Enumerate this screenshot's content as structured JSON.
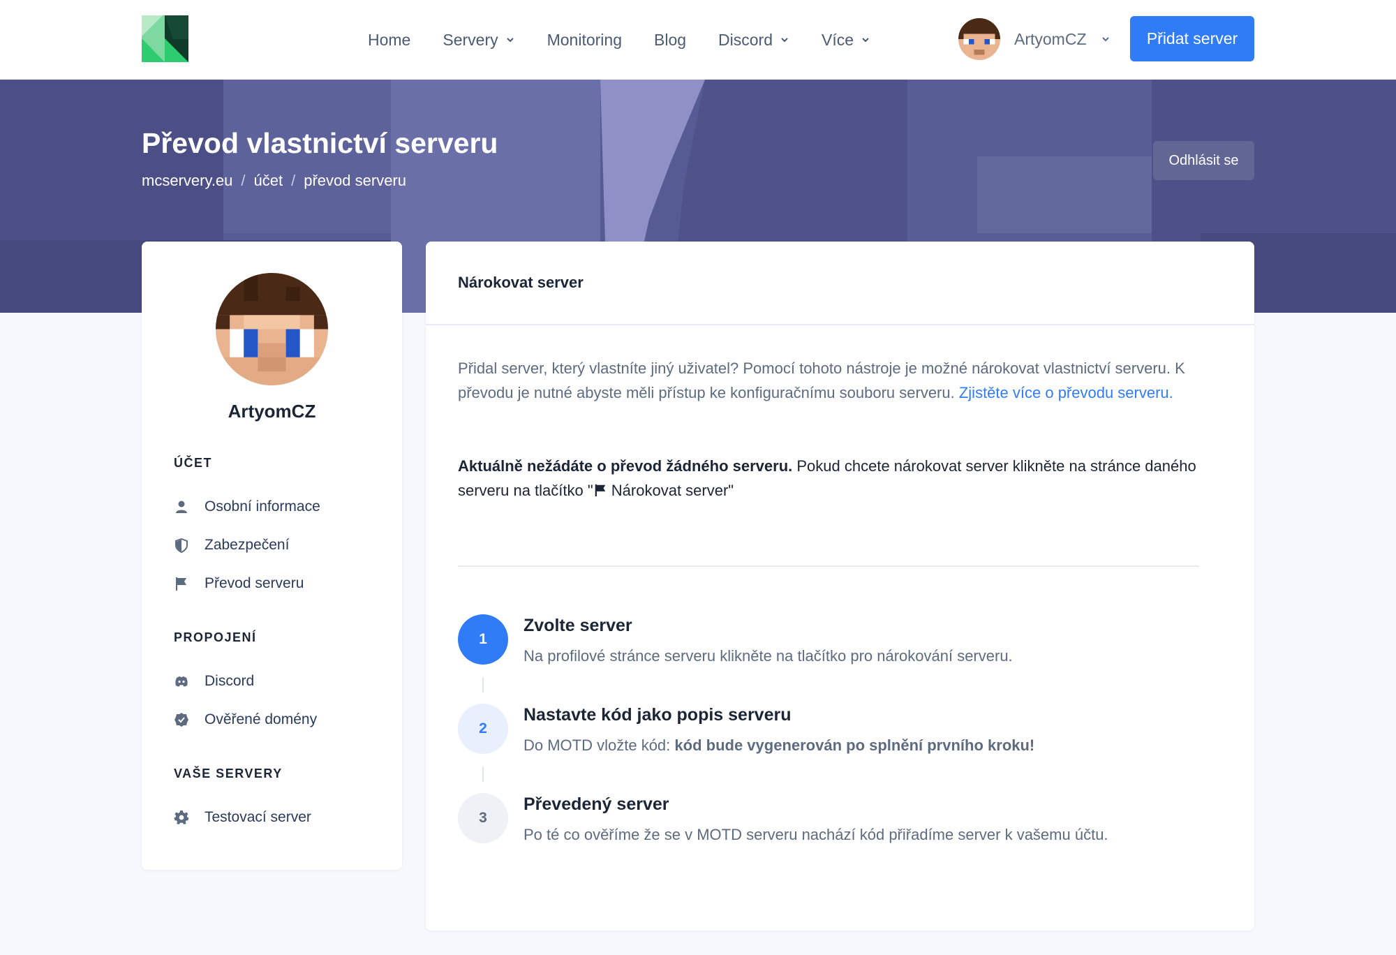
{
  "header": {
    "nav": [
      {
        "label": "Home",
        "dropdown": false
      },
      {
        "label": "Servery",
        "dropdown": true
      },
      {
        "label": "Monitoring",
        "dropdown": false
      },
      {
        "label": "Blog",
        "dropdown": false
      },
      {
        "label": "Discord",
        "dropdown": true
      },
      {
        "label": "Více",
        "dropdown": true
      }
    ],
    "username": "ArtyomCZ",
    "add_server_label": "Přidat server"
  },
  "hero": {
    "title": "Převod vlastnictví serveru",
    "breadcrumb": [
      "mcservery.eu",
      "účet",
      "převod serveru"
    ],
    "breadcrumb_sep": "/",
    "logout_label": "Odhlásit se"
  },
  "sidebar": {
    "username": "ArtyomCZ",
    "sections": [
      {
        "title": "ÚČET",
        "items": [
          {
            "label": "Osobní informace",
            "icon": "user-icon"
          },
          {
            "label": "Zabezpečení",
            "icon": "shield-icon"
          },
          {
            "label": "Převod serveru",
            "icon": "flag-icon"
          }
        ]
      },
      {
        "title": "PROPOJENÍ",
        "items": [
          {
            "label": "Discord",
            "icon": "discord-icon"
          },
          {
            "label": "Ověřené domény",
            "icon": "verified-badge-icon"
          }
        ]
      },
      {
        "title": "VAŠE SERVERY",
        "items": [
          {
            "label": "Testovací server",
            "icon": "gear-icon"
          }
        ]
      }
    ]
  },
  "main": {
    "card_title": "Nárokovat server",
    "intro_text": "Přidal server, který vlastníte jiný uživatel? Pomocí tohoto nástroje je možné nárokovat vlastnictví serveru. K převodu je nutné abyste měli přístup ke konfiguračnímu souboru serveru.",
    "intro_link": "Zjistěte více o převodu serveru.",
    "status_bold": "Aktuálně nežádáte o převod žádného serveru.",
    "status_text": "Pokud chcete nárokovat server klikněte na stránce daného serveru na tlačítko \"",
    "status_button_label": "Nárokovat server\"",
    "steps": [
      {
        "number": "1",
        "title": "Zvolte server",
        "desc": "Na profilové stránce serveru klikněte na tlačítko pro nárokování serveru.",
        "desc_bold": "",
        "state": "active"
      },
      {
        "number": "2",
        "title": "Nastavte kód jako popis serveru",
        "desc": "Do MOTD vložte kód:",
        "desc_bold": "kód bude vygenerován po splnění prvního kroku!",
        "state": "pending"
      },
      {
        "number": "3",
        "title": "Převedený server",
        "desc": "Po té co ověříme že se v MOTD serveru nachází kód přiřadíme server k vašemu účtu.",
        "desc_bold": "",
        "state": "inactive"
      }
    ]
  },
  "colors": {
    "accent": "#2f7cf6",
    "hero": "#5a5e95",
    "text": "#1b2536",
    "muted": "#5d6b80"
  }
}
